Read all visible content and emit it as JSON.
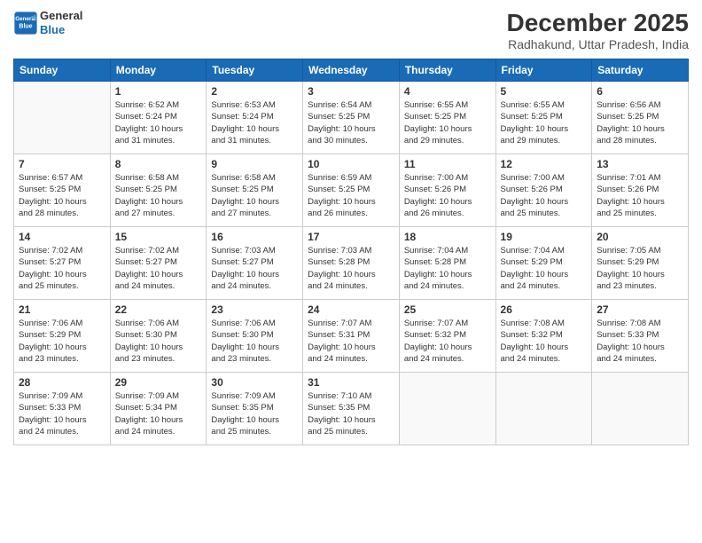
{
  "header": {
    "logo_line1": "General",
    "logo_line2": "Blue",
    "month": "December 2025",
    "location": "Radhakund, Uttar Pradesh, India"
  },
  "days_of_week": [
    "Sunday",
    "Monday",
    "Tuesday",
    "Wednesday",
    "Thursday",
    "Friday",
    "Saturday"
  ],
  "weeks": [
    [
      {
        "day": "",
        "info": ""
      },
      {
        "day": "1",
        "info": "Sunrise: 6:52 AM\nSunset: 5:24 PM\nDaylight: 10 hours\nand 31 minutes."
      },
      {
        "day": "2",
        "info": "Sunrise: 6:53 AM\nSunset: 5:24 PM\nDaylight: 10 hours\nand 31 minutes."
      },
      {
        "day": "3",
        "info": "Sunrise: 6:54 AM\nSunset: 5:25 PM\nDaylight: 10 hours\nand 30 minutes."
      },
      {
        "day": "4",
        "info": "Sunrise: 6:55 AM\nSunset: 5:25 PM\nDaylight: 10 hours\nand 29 minutes."
      },
      {
        "day": "5",
        "info": "Sunrise: 6:55 AM\nSunset: 5:25 PM\nDaylight: 10 hours\nand 29 minutes."
      },
      {
        "day": "6",
        "info": "Sunrise: 6:56 AM\nSunset: 5:25 PM\nDaylight: 10 hours\nand 28 minutes."
      }
    ],
    [
      {
        "day": "7",
        "info": "Sunrise: 6:57 AM\nSunset: 5:25 PM\nDaylight: 10 hours\nand 28 minutes."
      },
      {
        "day": "8",
        "info": "Sunrise: 6:58 AM\nSunset: 5:25 PM\nDaylight: 10 hours\nand 27 minutes."
      },
      {
        "day": "9",
        "info": "Sunrise: 6:58 AM\nSunset: 5:25 PM\nDaylight: 10 hours\nand 27 minutes."
      },
      {
        "day": "10",
        "info": "Sunrise: 6:59 AM\nSunset: 5:25 PM\nDaylight: 10 hours\nand 26 minutes."
      },
      {
        "day": "11",
        "info": "Sunrise: 7:00 AM\nSunset: 5:26 PM\nDaylight: 10 hours\nand 26 minutes."
      },
      {
        "day": "12",
        "info": "Sunrise: 7:00 AM\nSunset: 5:26 PM\nDaylight: 10 hours\nand 25 minutes."
      },
      {
        "day": "13",
        "info": "Sunrise: 7:01 AM\nSunset: 5:26 PM\nDaylight: 10 hours\nand 25 minutes."
      }
    ],
    [
      {
        "day": "14",
        "info": "Sunrise: 7:02 AM\nSunset: 5:27 PM\nDaylight: 10 hours\nand 25 minutes."
      },
      {
        "day": "15",
        "info": "Sunrise: 7:02 AM\nSunset: 5:27 PM\nDaylight: 10 hours\nand 24 minutes."
      },
      {
        "day": "16",
        "info": "Sunrise: 7:03 AM\nSunset: 5:27 PM\nDaylight: 10 hours\nand 24 minutes."
      },
      {
        "day": "17",
        "info": "Sunrise: 7:03 AM\nSunset: 5:28 PM\nDaylight: 10 hours\nand 24 minutes."
      },
      {
        "day": "18",
        "info": "Sunrise: 7:04 AM\nSunset: 5:28 PM\nDaylight: 10 hours\nand 24 minutes."
      },
      {
        "day": "19",
        "info": "Sunrise: 7:04 AM\nSunset: 5:29 PM\nDaylight: 10 hours\nand 24 minutes."
      },
      {
        "day": "20",
        "info": "Sunrise: 7:05 AM\nSunset: 5:29 PM\nDaylight: 10 hours\nand 23 minutes."
      }
    ],
    [
      {
        "day": "21",
        "info": "Sunrise: 7:06 AM\nSunset: 5:29 PM\nDaylight: 10 hours\nand 23 minutes."
      },
      {
        "day": "22",
        "info": "Sunrise: 7:06 AM\nSunset: 5:30 PM\nDaylight: 10 hours\nand 23 minutes."
      },
      {
        "day": "23",
        "info": "Sunrise: 7:06 AM\nSunset: 5:30 PM\nDaylight: 10 hours\nand 23 minutes."
      },
      {
        "day": "24",
        "info": "Sunrise: 7:07 AM\nSunset: 5:31 PM\nDaylight: 10 hours\nand 24 minutes."
      },
      {
        "day": "25",
        "info": "Sunrise: 7:07 AM\nSunset: 5:32 PM\nDaylight: 10 hours\nand 24 minutes."
      },
      {
        "day": "26",
        "info": "Sunrise: 7:08 AM\nSunset: 5:32 PM\nDaylight: 10 hours\nand 24 minutes."
      },
      {
        "day": "27",
        "info": "Sunrise: 7:08 AM\nSunset: 5:33 PM\nDaylight: 10 hours\nand 24 minutes."
      }
    ],
    [
      {
        "day": "28",
        "info": "Sunrise: 7:09 AM\nSunset: 5:33 PM\nDaylight: 10 hours\nand 24 minutes."
      },
      {
        "day": "29",
        "info": "Sunrise: 7:09 AM\nSunset: 5:34 PM\nDaylight: 10 hours\nand 24 minutes."
      },
      {
        "day": "30",
        "info": "Sunrise: 7:09 AM\nSunset: 5:35 PM\nDaylight: 10 hours\nand 25 minutes."
      },
      {
        "day": "31",
        "info": "Sunrise: 7:10 AM\nSunset: 5:35 PM\nDaylight: 10 hours\nand 25 minutes."
      },
      {
        "day": "",
        "info": ""
      },
      {
        "day": "",
        "info": ""
      },
      {
        "day": "",
        "info": ""
      }
    ]
  ]
}
